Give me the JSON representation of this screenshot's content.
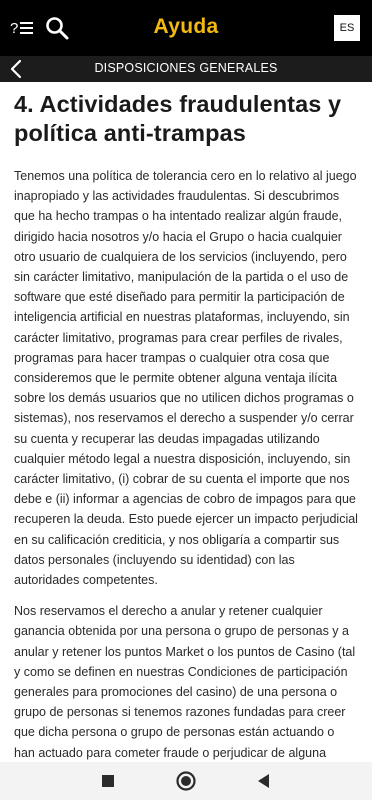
{
  "header": {
    "title": "Ayuda",
    "language": "ES"
  },
  "subheader": {
    "title": "DISPOSICIONES GENERALES"
  },
  "section": {
    "heading": "4. Actividades fraudulentas y política anti-trampas",
    "paragraphs": [
      "Tenemos una política de tolerancia cero en lo relativo al juego inapropiado y las actividades fraudulentas. Si descubrimos que ha hecho trampas o ha intentado realizar algún fraude, dirigido hacia nosotros y/o hacia el Grupo o hacia cualquier otro usuario de cualquiera de los servicios (incluyendo, pero sin carácter limitativo, manipulación de la partida o el uso de software que esté diseñado para permitir la participación de inteligencia artificial en nuestras plataformas, incluyendo, sin carácter limitativo, programas para crear perfiles de rivales, programas para hacer trampas o cualquier otra cosa que consideremos que le permite obtener alguna ventaja ilícita sobre los demás usuarios que no utilicen dichos programas o sistemas), nos reservamos el derecho a suspender y/o cerrar su cuenta y recuperar las deudas impagadas utilizando cualquier método legal a nuestra disposición, incluyendo, sin carácter limitativo, (i) cobrar de su cuenta el importe que nos debe e (ii) informar a agencias de cobro de impagos para que recuperen la deuda. Esto puede ejercer un impacto perjudicial en su calificación crediticia, y nos obligaría a compartir sus datos personales (incluyendo su identidad) con las autoridades competentes.",
      "Nos reservamos el derecho a anular y retener cualquier ganancia obtenida por una persona o grupo de personas y a anular y retener los puntos Market o los puntos de Casino (tal y como se definen en nuestras Condiciones de participación generales para promociones del casino) de una persona o grupo de personas si tenemos razones fundadas para creer que dicha persona o grupo de personas están actuando o han actuado para cometer fraude o perjudicar de alguna manera al Grupo y/o nosotros y/o a los servicios y/o a las plataformas."
    ]
  },
  "icons": {
    "menu": "help-menu-icon",
    "search": "search-icon",
    "back": "back-chevron-icon",
    "recents": "square-recents-icon",
    "home": "circle-home-icon",
    "nav_back": "triangle-back-icon"
  },
  "colors": {
    "header_bg": "#000000",
    "accent": "#f2b90f",
    "subheader_bg": "#1c1c1c",
    "text": "#2a2a2a",
    "navbar_bg": "#f3f3f3"
  }
}
